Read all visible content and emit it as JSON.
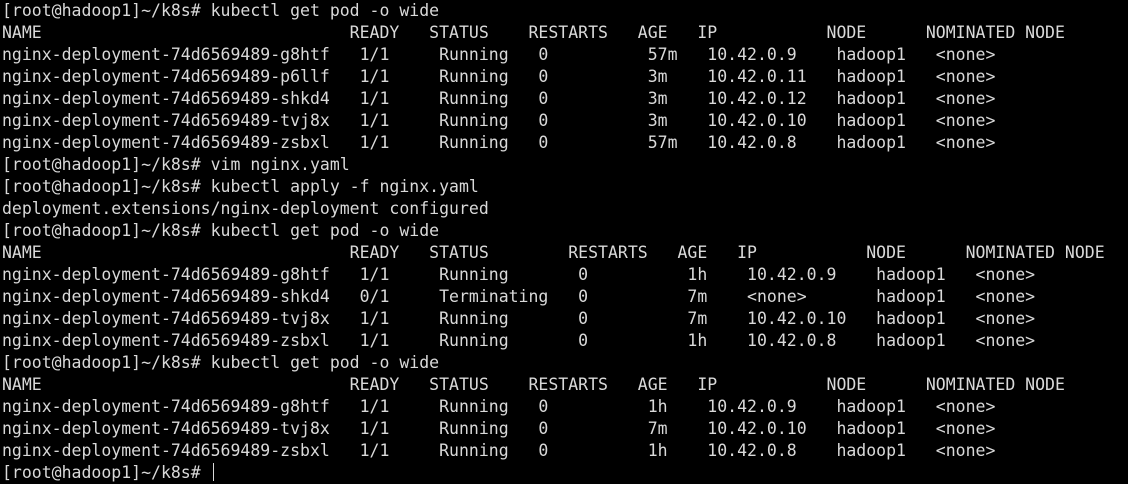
{
  "terminal": {
    "lines": [
      "[root@hadoop1]~/k8s# kubectl get pod -o wide",
      "NAME                               READY   STATUS    RESTARTS   AGE   IP           NODE      NOMINATED NODE",
      "nginx-deployment-74d6569489-g8htf   1/1     Running   0          57m   10.42.0.9    hadoop1   <none>",
      "nginx-deployment-74d6569489-p6llf   1/1     Running   0          3m    10.42.0.11   hadoop1   <none>",
      "nginx-deployment-74d6569489-shkd4   1/1     Running   0          3m    10.42.0.12   hadoop1   <none>",
      "nginx-deployment-74d6569489-tvj8x   1/1     Running   0          3m    10.42.0.10   hadoop1   <none>",
      "nginx-deployment-74d6569489-zsbxl   1/1     Running   0          57m   10.42.0.8    hadoop1   <none>",
      "[root@hadoop1]~/k8s# vim nginx.yaml",
      "[root@hadoop1]~/k8s# kubectl apply -f nginx.yaml",
      "deployment.extensions/nginx-deployment configured",
      "[root@hadoop1]~/k8s# kubectl get pod -o wide",
      "NAME                               READY   STATUS        RESTARTS   AGE   IP           NODE      NOMINATED NODE",
      "nginx-deployment-74d6569489-g8htf   1/1     Running       0          1h    10.42.0.9    hadoop1   <none>",
      "nginx-deployment-74d6569489-shkd4   0/1     Terminating   0          7m    <none>       hadoop1   <none>",
      "nginx-deployment-74d6569489-tvj8x   1/1     Running       0          7m    10.42.0.10   hadoop1   <none>",
      "nginx-deployment-74d6569489-zsbxl   1/1     Running       0          1h    10.42.0.8    hadoop1   <none>",
      "[root@hadoop1]~/k8s# kubectl get pod -o wide",
      "NAME                               READY   STATUS    RESTARTS   AGE   IP           NODE      NOMINATED NODE",
      "nginx-deployment-74d6569489-g8htf   1/1     Running   0          1h    10.42.0.9    hadoop1   <none>",
      "nginx-deployment-74d6569489-tvj8x   1/1     Running   0          7m    10.42.0.10   hadoop1   <none>",
      "nginx-deployment-74d6569489-zsbxl   1/1     Running   0          1h    10.42.0.8    hadoop1   <none>"
    ],
    "prompt": "[root@hadoop1]~/k8s# ",
    "colors": {
      "background": "#000000",
      "foreground": "#d9d9d9"
    }
  }
}
